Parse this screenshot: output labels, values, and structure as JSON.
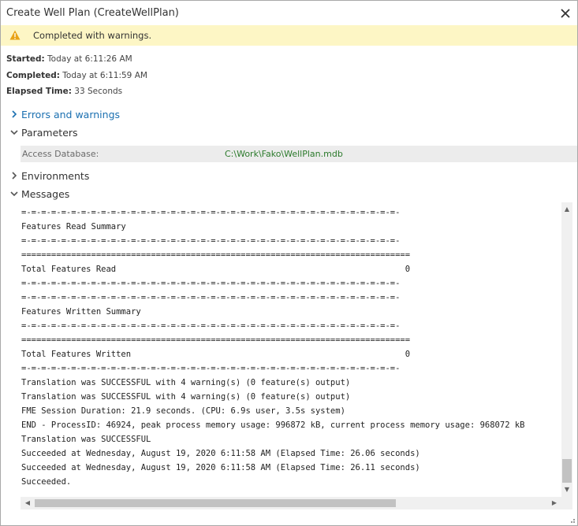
{
  "window": {
    "title": "Create Well Plan (CreateWellPlan)"
  },
  "status": {
    "message": "Completed with warnings.",
    "icon": "warning-icon",
    "color": "#fdf6c5"
  },
  "meta": {
    "started_label": "Started:",
    "started_value": "Today at 6:11:26 AM",
    "completed_label": "Completed:",
    "completed_value": "Today at 6:11:59 AM",
    "elapsed_label": "Elapsed Time:",
    "elapsed_value": "33 Seconds"
  },
  "sections": {
    "errors": "Errors and warnings",
    "parameters": "Parameters",
    "environments": "Environments",
    "messages": "Messages"
  },
  "parameters": {
    "access_db_label": "Access Database:",
    "access_db_value": "C:\\Work\\Fako\\WellPlan.mdb"
  },
  "messages": [
    "=-=-=-=-=-=-=-=-=-=-=-=-=-=-=-=-=-=-=-=-=-=-=-=-=-=-=-=-=-=-=-=-=-=-=-=-=-=-",
    "Features Read Summary",
    "=-=-=-=-=-=-=-=-=-=-=-=-=-=-=-=-=-=-=-=-=-=-=-=-=-=-=-=-=-=-=-=-=-=-=-=-=-=-",
    "==============================================================================",
    "Total Features Read                                                          0",
    "=-=-=-=-=-=-=-=-=-=-=-=-=-=-=-=-=-=-=-=-=-=-=-=-=-=-=-=-=-=-=-=-=-=-=-=-=-=-",
    "=-=-=-=-=-=-=-=-=-=-=-=-=-=-=-=-=-=-=-=-=-=-=-=-=-=-=-=-=-=-=-=-=-=-=-=-=-=-",
    "Features Written Summary",
    "=-=-=-=-=-=-=-=-=-=-=-=-=-=-=-=-=-=-=-=-=-=-=-=-=-=-=-=-=-=-=-=-=-=-=-=-=-=-",
    "==============================================================================",
    "Total Features Written                                                       0",
    "=-=-=-=-=-=-=-=-=-=-=-=-=-=-=-=-=-=-=-=-=-=-=-=-=-=-=-=-=-=-=-=-=-=-=-=-=-=-",
    "Translation was SUCCESSFUL with 4 warning(s) (0 feature(s) output)",
    "Translation was SUCCESSFUL with 4 warning(s) (0 feature(s) output)",
    "FME Session Duration: 21.9 seconds. (CPU: 6.9s user, 3.5s system)",
    "END - ProcessID: 46924, peak process memory usage: 996872 kB, current process memory usage: 968072 kB",
    "Translation was SUCCESSFUL",
    "Succeeded at Wednesday, August 19, 2020 6:11:58 AM (Elapsed Time: 26.06 seconds)",
    "Succeeded at Wednesday, August 19, 2020 6:11:58 AM (Elapsed Time: 26.11 seconds)",
    "Succeeded."
  ],
  "colors": {
    "link": "#1a6fb0",
    "param_value": "#2b7a2b",
    "param_row_bg": "#ececec"
  }
}
